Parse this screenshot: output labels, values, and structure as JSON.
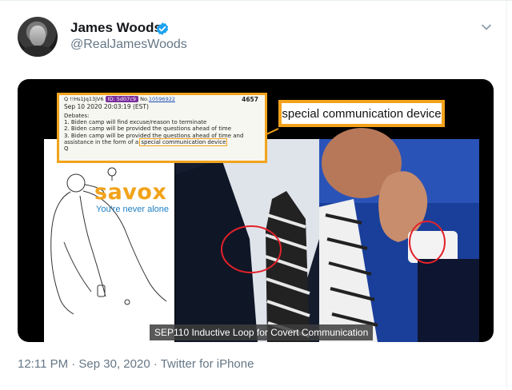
{
  "tweet": {
    "author_name": "James Woods",
    "author_handle": "@RealJamesWoods",
    "verified": true,
    "timestamp": "12:11 PM · Sep 30, 2020 · Twitter for iPhone"
  },
  "media": {
    "qpost": {
      "header_prefix": "Q !!Hs1Jq13jV6",
      "header_id": "ID: 5d07c9",
      "header_no": "No.",
      "header_link": "10596922",
      "number": "4657",
      "date": "Sep 10 2020 20:03:19 (EST)",
      "lines": [
        "Debates:",
        "1. Biden camp will find excuse/reason to terminate",
        "2. Biden camp will be provided the questions ahead of time",
        "3. Biden camp will be provided the questions ahead of time and"
      ],
      "line_last_prefix": "assistance in the form of a ",
      "line_last_highlight": "special communication device",
      "signature": "Q"
    },
    "callout": "special communication device",
    "brand": "savox",
    "tagline": "You're never alone",
    "caption": "SEP110 Inductive Loop for Covert Communication"
  },
  "colors": {
    "accent_orange": "#f2a31b",
    "verified_blue": "#1da1f2",
    "secondary_text": "#657786",
    "circle_red": "#e3222b"
  }
}
